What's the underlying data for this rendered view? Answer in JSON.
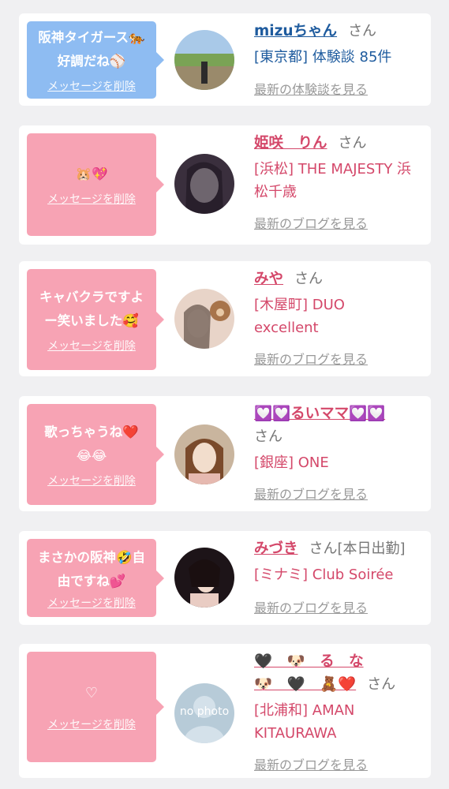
{
  "delete_label": "メッセージを削除",
  "colors": {
    "blue_accent": "#1e5b9e",
    "pink_accent": "#d4486a",
    "bubble_blue": "#8ebcf2",
    "bubble_pink": "#f7a3b4"
  },
  "items": [
    {
      "message": "阪神タイガース🐅\n好調だね⚾",
      "name": "mizuちゃん",
      "honorific": "さん",
      "shop": "[東京都] 体験談 85件",
      "link": "最新の体験談を見る"
    },
    {
      "message": "🐹💖",
      "name": "姫咲　りん",
      "honorific": "さん",
      "shop": "[浜松] THE MAJESTY 浜松千歳",
      "link": "最新のブログを見る"
    },
    {
      "message": "キャバクラですよ\nー笑いました🥰",
      "name": "みや",
      "honorific": "さん",
      "shop": "[木屋町] DUO excellent",
      "link": "最新のブログを見る"
    },
    {
      "message": "歌っちゃうね❤️\n😂😂",
      "name": "💟💟るいママ💟💟",
      "honorific": "さん",
      "shop": "[銀座] ONE",
      "link": "最新のブログを見る"
    },
    {
      "message": "まさかの阪神🤣自\n由ですね💕",
      "name": "みづき",
      "honorific": "さん[本日出勤]",
      "shop": "[ミナミ] Club Soirée",
      "link": "最新のブログを見る"
    },
    {
      "message": "♡",
      "name": "🖤　🐶　る　な\n🐶　🖤　🧸❤️",
      "honorific": "さん",
      "shop": "[北浦和] AMAN KITAURAWA",
      "link": "最新のブログを見る"
    }
  ],
  "avatar_placeholder_text": "no photo"
}
